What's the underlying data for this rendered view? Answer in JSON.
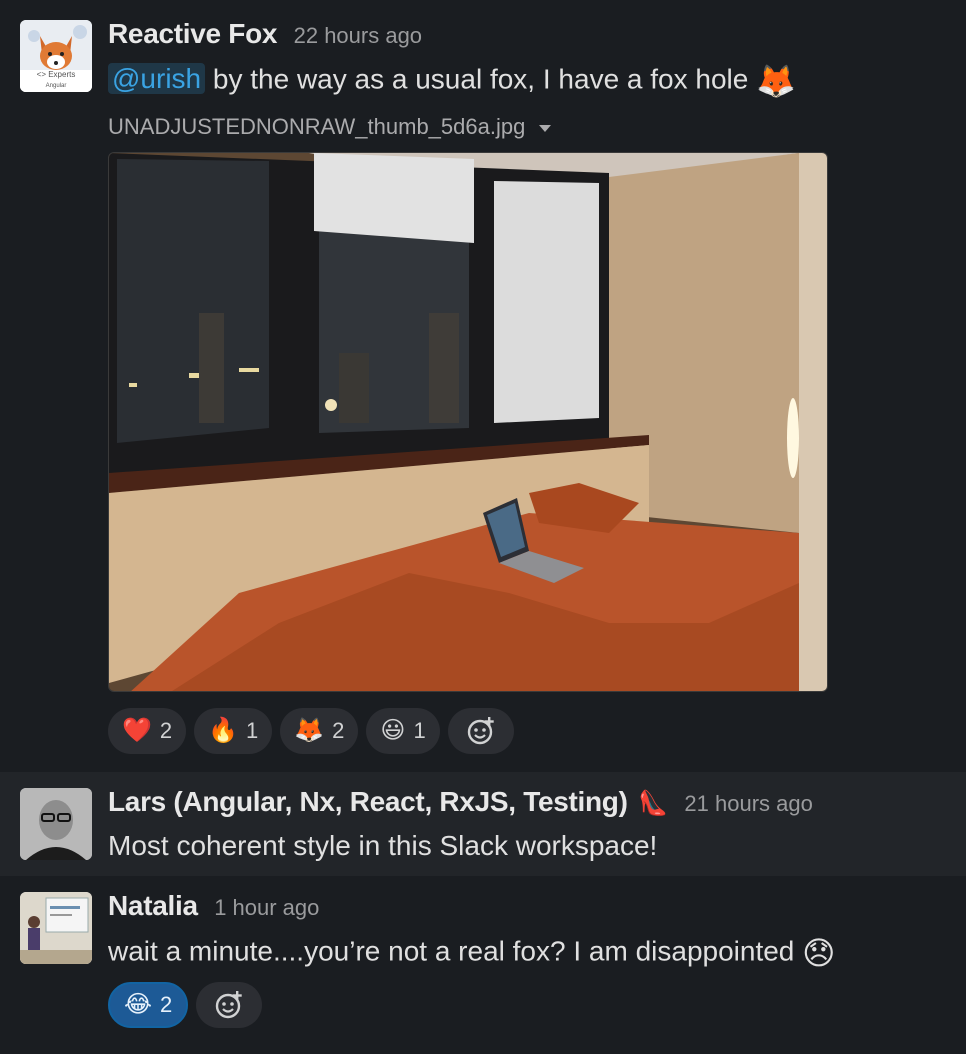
{
  "messages": [
    {
      "author": "Reactive Fox",
      "time": "22 hours ago",
      "mention": "@urish",
      "text": " by the way as a usual fox, I have a fox hole ",
      "text_emoji": "🦊",
      "avatar_caption": "<> Experts",
      "avatar_caption2": "Angular",
      "file": {
        "name": "UNADJUSTEDNONRAW_thumb_5d6a.jpg"
      },
      "reactions": [
        {
          "emoji": "❤️",
          "count": "2",
          "icon": "heart-icon"
        },
        {
          "emoji": "🔥",
          "count": "1",
          "icon": "fire-icon"
        },
        {
          "emoji": "🦊",
          "count": "2",
          "icon": "fox-icon"
        },
        {
          "emoji": "😃",
          "count": "1",
          "icon": "smiley-icon"
        }
      ]
    },
    {
      "author": "Lars (Angular, Nx, React, RxJS, Testing)",
      "status_emoji": "👠",
      "time": "21 hours ago",
      "text": "Most coherent style in this Slack workspace!"
    },
    {
      "author": "Natalia",
      "time": "1 hour ago",
      "text": "wait a minute....you’re not a real fox? I am disappointed ",
      "text_emoji": "😞",
      "reactions": [
        {
          "emoji": "😂",
          "count": "2",
          "icon": "joy-icon",
          "active": true
        }
      ]
    }
  ],
  "colors": {
    "background": "#1a1d21",
    "hover_row": "#222529",
    "mention": "#3aa3e3",
    "active_reaction": "#1d5a96"
  }
}
